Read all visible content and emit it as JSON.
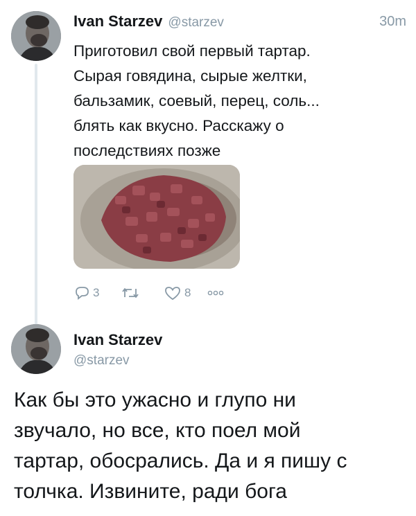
{
  "tweet1": {
    "name": "Ivan Starzev",
    "handle": "@starzev",
    "time": "30m",
    "lines": [
      "Приготовил свой первый тартар.",
      "Сырая говядина, сырые желтки,",
      "бальзамик, соевый, перец, соль...",
      "блять как вкусно. Расскажу о",
      "последствиях позже"
    ],
    "actions": {
      "reply_count": "3",
      "like_count": "8",
      "reply_icon": "reply-icon",
      "retweet_icon": "retweet-icon",
      "like_icon": "heart-icon",
      "more_icon": "more-icon"
    }
  },
  "tweet2": {
    "name": "Ivan Starzev",
    "handle": "@starzev",
    "lines": [
      "Как бы это ужасно и глупо ни",
      "звучало, но все, кто поел мой",
      "тартар, обосрались. Да и я пишу с",
      "толчка. Извините, ради бога"
    ]
  },
  "colors": {
    "text": "#14171a",
    "secondary": "#8899a6",
    "thread_line": "#e1e8ed"
  }
}
